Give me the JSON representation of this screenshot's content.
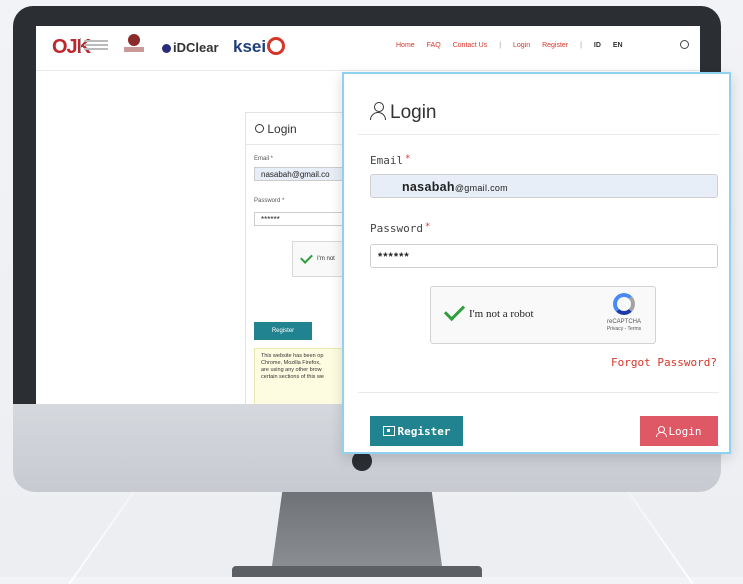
{
  "header": {
    "logos": [
      "OJK",
      "iDClear",
      "ksei"
    ],
    "nav": [
      "Home",
      "FAQ",
      "Contact Us",
      "|",
      "Login",
      "Register",
      "|"
    ],
    "langs": [
      "ID",
      "EN"
    ]
  },
  "small_form": {
    "title": "Login",
    "email_label": "Email *",
    "email_value": "nasabah@gmail.co",
    "password_label": "Password *",
    "password_value": "******",
    "captcha_text": "I'm not",
    "register_label": "Register",
    "notice": "This website has been op\nChrome, Mozilla Firefox,\nare using any other brow\ncertain sections of this we"
  },
  "login_card": {
    "title": "Login",
    "email_label": "Email",
    "email_value_bold": "nasabah",
    "email_value_rest": "@gmail.com",
    "password_label": "Password",
    "required_mark": "*",
    "password_value": "******",
    "captcha_label": "I'm not a robot",
    "captcha_brand": "reCAPTCHA",
    "captcha_links": "Privacy - Terms",
    "forgot_label": "Forgot Password?",
    "register_label": "Register",
    "login_label": "Login"
  },
  "colors": {
    "teal": "#20838f",
    "red": "#df5866",
    "link_red": "#d6352a",
    "highlight_border": "#8fd1f0"
  }
}
